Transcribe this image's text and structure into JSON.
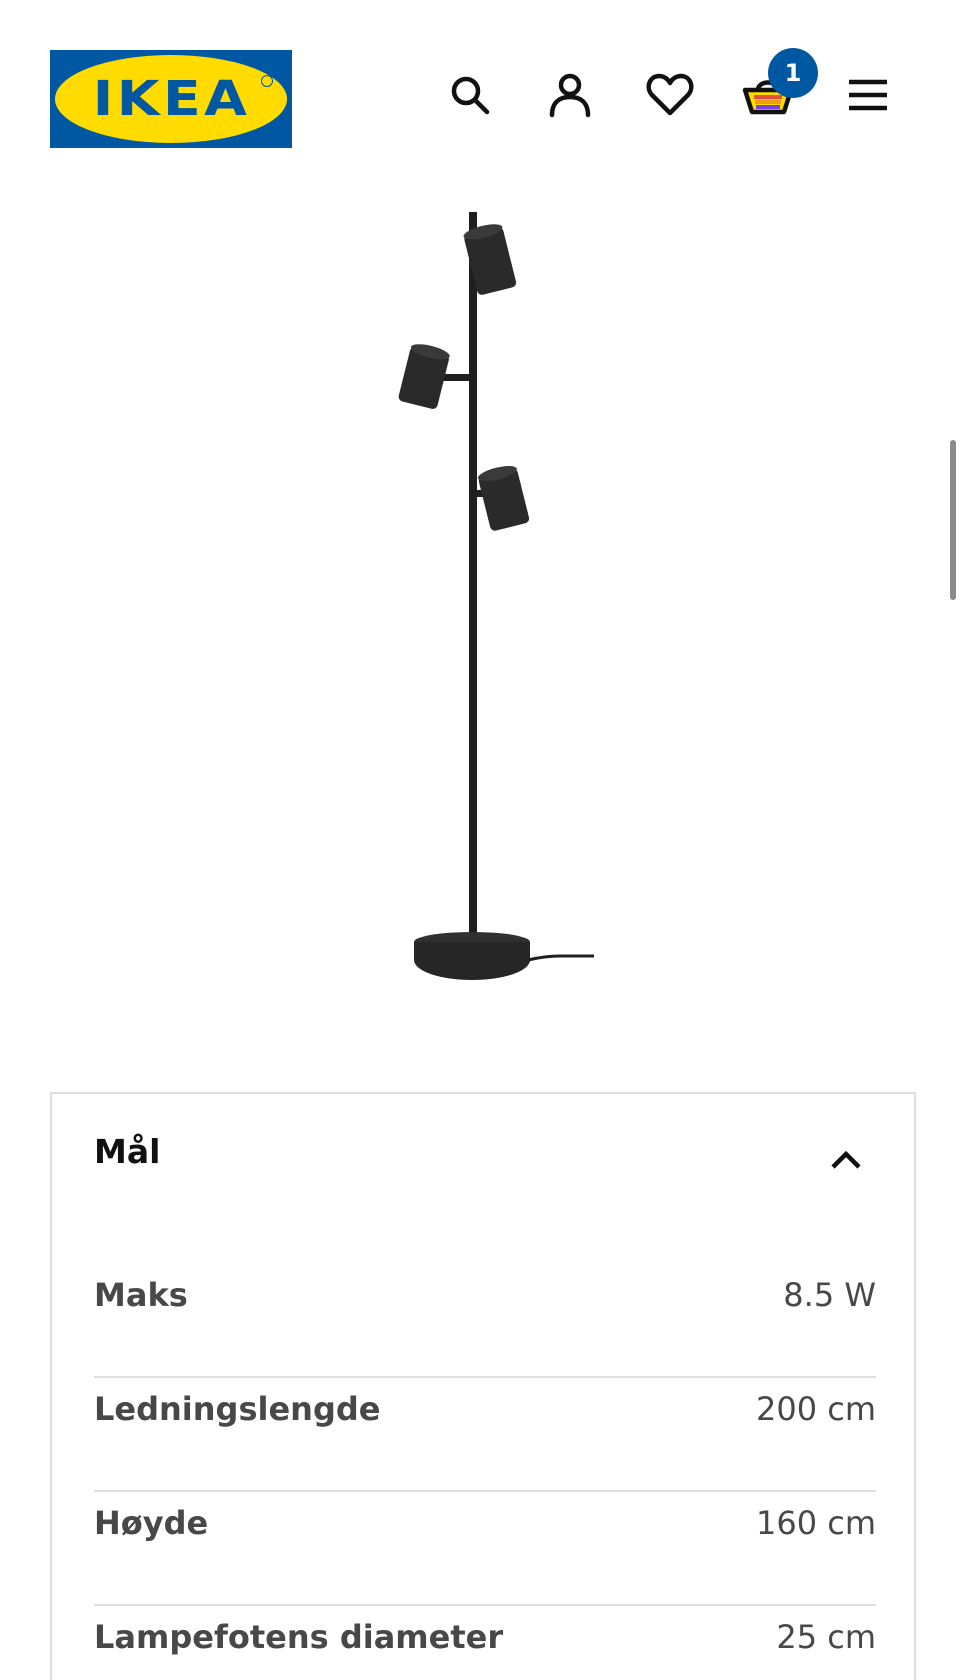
{
  "header": {
    "logo_text": "IKEA",
    "icons": [
      "search-icon",
      "user-icon",
      "heart-icon",
      "cart-icon",
      "menu-icon"
    ],
    "cart_count": "1",
    "colors": {
      "brand_blue": "#0058a3",
      "brand_yellow": "#ffdb00"
    }
  },
  "product_image": {
    "subject": "floor-lamp-with-three-spotlights"
  },
  "dimensions": {
    "title": "Mål",
    "expanded": true,
    "specs": [
      {
        "label": "Maks",
        "value": "8.5 W"
      },
      {
        "label": "Ledningslengde",
        "value": "200 cm"
      },
      {
        "label": "Høyde",
        "value": "160 cm"
      },
      {
        "label": "Lampefotens diameter",
        "value": "25 cm"
      }
    ]
  }
}
